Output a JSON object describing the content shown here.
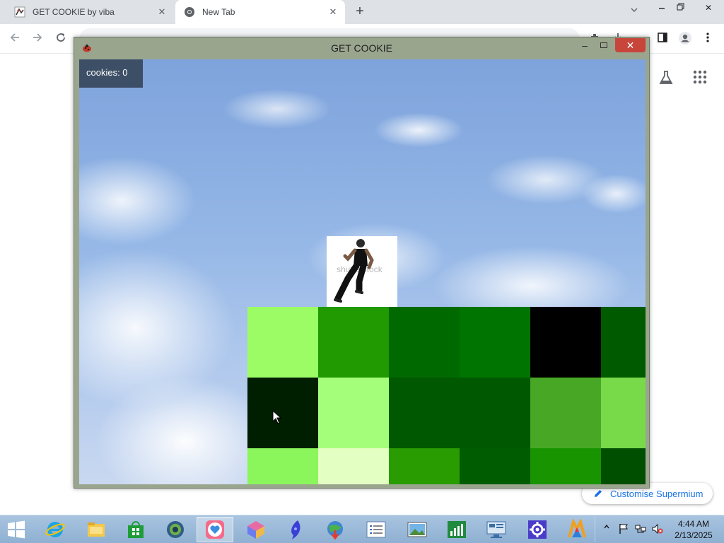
{
  "browser": {
    "tabs": [
      {
        "title": "GET COOKIE by viba",
        "active": false
      },
      {
        "title": "New Tab",
        "active": true
      }
    ],
    "new_tab_symbol": "+",
    "customise_label": "Customise Supermium",
    "icons": [
      "back-arrow-icon",
      "forward-arrow-icon",
      "reload-icon",
      "extensions-icon",
      "side-panel-icon",
      "profile-icon",
      "kebab-menu-icon",
      "lab-flask-icon",
      "apps-grid-icon",
      "pencil-icon"
    ]
  },
  "game": {
    "window_title": "GET COOKIE",
    "cookie_counter": "cookies: 0",
    "watermark_text": "shutterstock",
    "grid": {
      "columns": 6,
      "rows": [
        [
          "#9cfc66",
          "#209a00",
          "#006a00",
          "#007400",
          "#000000",
          "#005a00"
        ],
        [
          "#001e00",
          "#a4fe7a",
          "#005800",
          "#005800",
          "#48a826",
          "#78da48"
        ],
        [
          "#8af65c",
          "#e4ffc2",
          "#289c00",
          "#005c00",
          "#189400",
          "#004e00"
        ]
      ]
    }
  },
  "taskbar": {
    "apps": [
      "internet-explorer",
      "file-explorer",
      "store",
      "chrome-like",
      "heart-app",
      "cube-app",
      "feather-app",
      "globe-download",
      "list-app",
      "photos-app",
      "chart-app",
      "monitor-app",
      "settings-app",
      "office-app"
    ],
    "clock_time": "4:44 AM",
    "clock_date": "2/13/2025"
  },
  "colors": {
    "accent_blue": "#1a73e8",
    "close_red": "#c7453b",
    "counter_bg": "#3d4f66",
    "window_frame": "#9aa58e"
  }
}
